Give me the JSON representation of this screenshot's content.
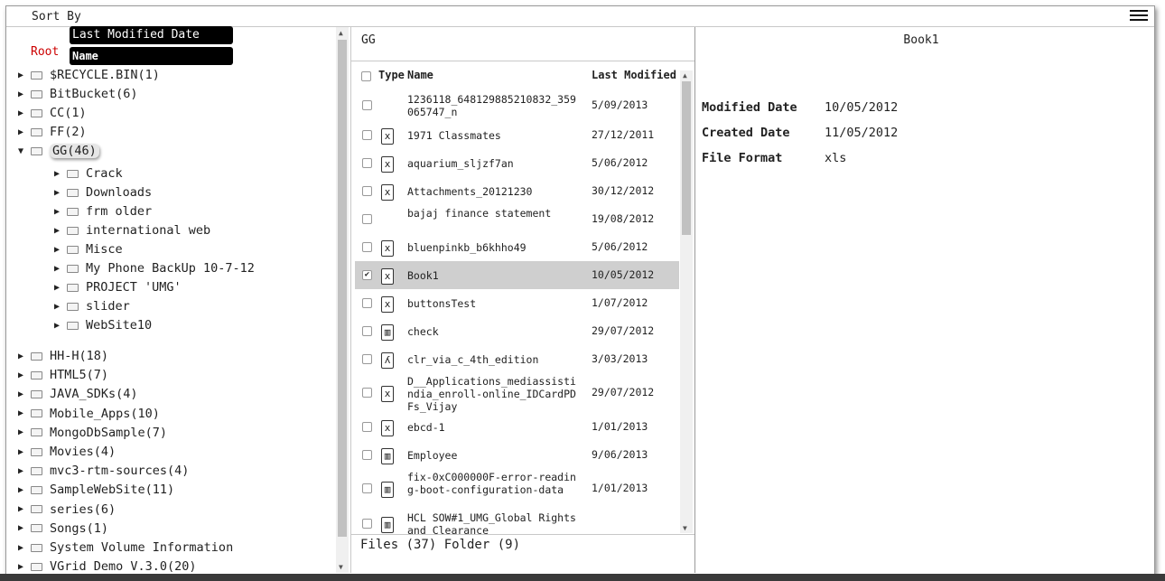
{
  "sort": {
    "label": "Sort By",
    "options": [
      "Last Modified Date",
      "Name"
    ]
  },
  "tree": {
    "root_label": "Root",
    "items_before": [
      {
        "label": "$RECYCLE.BIN(1)"
      },
      {
        "label": "BitBucket(6)"
      },
      {
        "label": "CC(1)"
      },
      {
        "label": "FF(2)"
      }
    ],
    "expanded": {
      "label": "GG(46)",
      "children": [
        {
          "label": "Crack"
        },
        {
          "label": "Downloads"
        },
        {
          "label": "frm older"
        },
        {
          "label": "international web"
        },
        {
          "label": "Misce"
        },
        {
          "label": "My Phone BackUp 10-7-12"
        },
        {
          "label": "PROJECT 'UMG'"
        },
        {
          "label": "slider"
        },
        {
          "label": "WebSite10"
        }
      ]
    },
    "items_after": [
      {
        "label": "HH-H(18)"
      },
      {
        "label": "HTML5(7)"
      },
      {
        "label": "JAVA_SDKs(4)"
      },
      {
        "label": "Mobile_Apps(10)"
      },
      {
        "label": "MongoDbSample(7)"
      },
      {
        "label": "Movies(4)"
      },
      {
        "label": "mvc3-rtm-sources(4)"
      },
      {
        "label": "SampleWebSite(11)"
      },
      {
        "label": "series(6)"
      },
      {
        "label": "Songs(1)"
      },
      {
        "label": "System Volume Information"
      },
      {
        "label": "VGrid Demo V.3.0(20)"
      }
    ]
  },
  "files": {
    "folder_title": "GG",
    "columns": {
      "type": "Type",
      "name": "Name",
      "modified": "Last Modified"
    },
    "rows": [
      {
        "name": "1236118_648129885210832_359065747_n",
        "date": "5/09/2013",
        "icon": "none",
        "checked": false
      },
      {
        "name": "1971 Classmates",
        "date": "27/12/2011",
        "icon": "excel-icon",
        "checked": false
      },
      {
        "name": "aquarium_sljzf7an",
        "date": "5/06/2012",
        "icon": "excel-icon",
        "checked": false
      },
      {
        "name": "Attachments_20121230",
        "date": "30/12/2012",
        "icon": "excel-icon",
        "checked": false
      },
      {
        "name": "bajaj finance statement",
        "date": "19/08/2012",
        "icon": "none",
        "checked": false
      },
      {
        "name": "bluenpinkb_b6khho49",
        "date": "5/06/2012",
        "icon": "excel-icon",
        "checked": false
      },
      {
        "name": "Book1",
        "date": "10/05/2012",
        "icon": "excel-icon",
        "checked": true
      },
      {
        "name": "buttonsTest",
        "date": "1/07/2012",
        "icon": "excel-icon",
        "checked": false
      },
      {
        "name": "check",
        "date": "29/07/2012",
        "icon": "database-icon",
        "checked": false
      },
      {
        "name": "clr_via_c_4th_edition",
        "date": "3/03/2013",
        "icon": "pdf-icon",
        "checked": false
      },
      {
        "name": "D__Applications_mediassistindia_enroll-online_IDCardPDFs_Vijay",
        "date": "29/07/2012",
        "icon": "excel-icon",
        "checked": false
      },
      {
        "name": "ebcd-1",
        "date": "1/01/2013",
        "icon": "excel-icon",
        "checked": false
      },
      {
        "name": "Employee",
        "date": "9/06/2013",
        "icon": "database-icon",
        "checked": false
      },
      {
        "name": "fix-0xC000000F-error-reading-boot-configuration-data",
        "date": "1/01/2013",
        "icon": "database-icon",
        "checked": false
      },
      {
        "name": "HCL SOW#1_UMG_Global Rights and Clearance",
        "date": "",
        "icon": "database-icon",
        "checked": false
      }
    ],
    "footer": "Files (37) Folder (9)"
  },
  "details": {
    "title": "Book1",
    "fields": [
      {
        "label": "Modified Date",
        "value": "10/05/2012"
      },
      {
        "label": "Created Date",
        "value": "11/05/2012"
      },
      {
        "label": "File Format",
        "value": "xls"
      }
    ]
  }
}
